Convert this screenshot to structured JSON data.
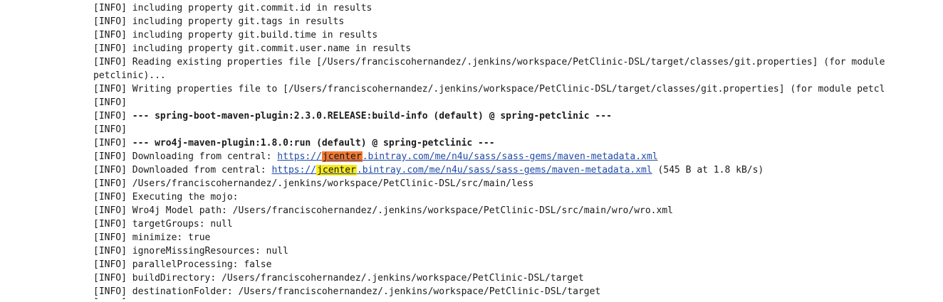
{
  "log": {
    "prefix": "[INFO] ",
    "lines": [
      {
        "type": "text",
        "text": "including property git.commit.id in results"
      },
      {
        "type": "text",
        "text": "including property git.tags in results"
      },
      {
        "type": "text",
        "text": "including property git.build.time in results"
      },
      {
        "type": "text",
        "text": "including property git.commit.user.name in results"
      },
      {
        "type": "wrap",
        "text": "Reading existing properties file [/Users/franciscohernandez/.jenkins/workspace/PetClinic-DSL/target/classes/git.properties] (for module",
        "cont": "petclinic)..."
      },
      {
        "type": "text",
        "text": "Writing properties file to [/Users/franciscohernandez/.jenkins/workspace/PetClinic-DSL/target/classes/git.properties] (for module petcl"
      },
      {
        "type": "text",
        "text": ""
      },
      {
        "type": "bold",
        "text": "--- spring-boot-maven-plugin:2.3.0.RELEASE:build-info (default) @ spring-petclinic ---"
      },
      {
        "type": "text",
        "text": ""
      },
      {
        "type": "bold",
        "text": "--- wro4j-maven-plugin:1.8.0:run (default) @ spring-petclinic ---"
      },
      {
        "type": "link",
        "before": "Downloading from central: ",
        "link_pre": "https://",
        "link_hl": "jcenter",
        "link_post": ".bintray.com/me/n4u/sass/sass-gems/maven-metadata.xml",
        "after": "",
        "hl_color": "#f07a35"
      },
      {
        "type": "link",
        "before": "Downloaded from central: ",
        "link_pre": "https://",
        "link_hl": "jcenter",
        "link_post": ".bintray.com/me/n4u/sass/sass-gems/maven-metadata.xml",
        "after": " (545 B at 1.8 kB/s)",
        "hl_color": "#f7ea1c"
      },
      {
        "type": "text",
        "text": "/Users/franciscohernandez/.jenkins/workspace/PetClinic-DSL/src/main/less"
      },
      {
        "type": "text",
        "text": "Executing the mojo:"
      },
      {
        "type": "text",
        "text": "Wro4j Model path: /Users/franciscohernandez/.jenkins/workspace/PetClinic-DSL/src/main/wro/wro.xml"
      },
      {
        "type": "text",
        "text": "targetGroups: null"
      },
      {
        "type": "text",
        "text": "minimize: true"
      },
      {
        "type": "text",
        "text": "ignoreMissingResources: null"
      },
      {
        "type": "text",
        "text": "parallelProcessing: false"
      },
      {
        "type": "text",
        "text": "buildDirectory: /Users/franciscohernandez/.jenkins/workspace/PetClinic-DSL/target"
      },
      {
        "type": "text",
        "text": "destinationFolder: /Users/franciscohernandez/.jenkins/workspace/PetClinic-DSL/target"
      }
    ]
  }
}
